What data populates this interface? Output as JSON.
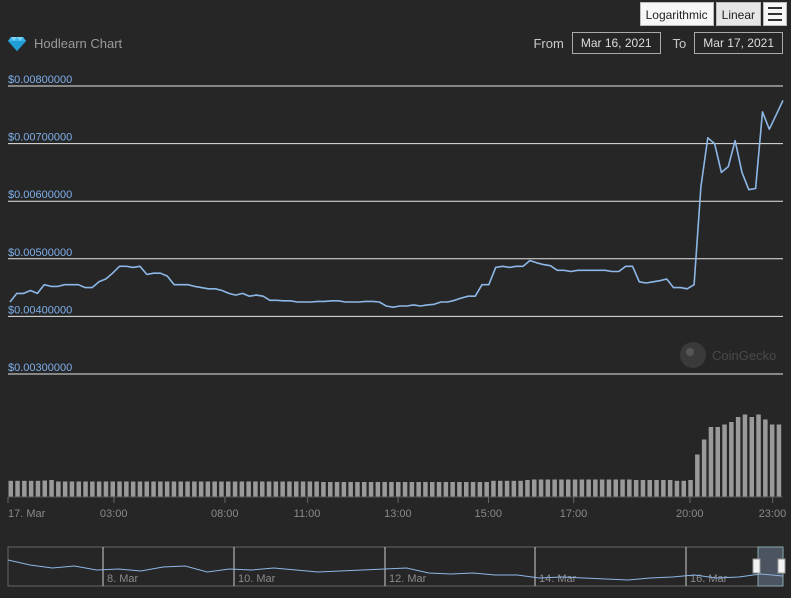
{
  "toolbar": {
    "logarithmic_label": "Logarithmic",
    "linear_label": "Linear"
  },
  "header": {
    "title": "Hodlearn Chart",
    "from_label": "From",
    "from_value": "Mar 16, 2021",
    "to_label": "To",
    "to_value": "Mar 17, 2021"
  },
  "watermark": "CoinGecko",
  "colors": {
    "background": "#262626",
    "line": "#8db7e6",
    "axis_label": "#7fb0ea",
    "grid": "#e6e6e6",
    "volume": "#9a9a9a"
  },
  "chart_data": {
    "type": "line",
    "title": "",
    "xlabel": "",
    "ylabel": "",
    "ylim": [
      0.003,
      0.008
    ],
    "yticks": [
      "$0.00800000",
      "$0.00700000",
      "$0.00600000",
      "$0.00500000",
      "$0.00400000",
      "$0.00300000"
    ],
    "ytick_values": [
      0.008,
      0.007,
      0.006,
      0.005,
      0.004,
      0.003
    ],
    "xticks": [
      "17. Mar",
      "03:00",
      "08:00",
      "11:00",
      "13:00",
      "15:00",
      "17:00",
      "20:00",
      "23:00"
    ],
    "xtick_hours": [
      0,
      4.1,
      8.4,
      11.6,
      15.1,
      18.6,
      21.9,
      26.4,
      29.6
    ],
    "x_hours_max": 30.0,
    "series": [
      {
        "values": [
          0.00425,
          0.0044,
          0.0044,
          0.00445,
          0.0044,
          0.00455,
          0.00452,
          0.00452,
          0.00455,
          0.00455,
          0.00455,
          0.0045,
          0.0045,
          0.0046,
          0.00465,
          0.00475,
          0.00487,
          0.00487,
          0.00485,
          0.00487,
          0.00473,
          0.00475,
          0.00475,
          0.0047,
          0.00455,
          0.00455,
          0.00455,
          0.00452,
          0.0045,
          0.00448,
          0.00448,
          0.00445,
          0.0044,
          0.00437,
          0.0044,
          0.00435,
          0.00437,
          0.00435,
          0.00428,
          0.00428,
          0.00427,
          0.00427,
          0.00425,
          0.00425,
          0.00425,
          0.00426,
          0.00426,
          0.00427,
          0.00427,
          0.00425,
          0.00425,
          0.00425,
          0.00426,
          0.00426,
          0.00425,
          0.00418,
          0.00416,
          0.00418,
          0.00418,
          0.0042,
          0.00418,
          0.0042,
          0.00421,
          0.00425,
          0.00425,
          0.00428,
          0.00432,
          0.00435,
          0.00435,
          0.00455,
          0.00455,
          0.00485,
          0.00487,
          0.00485,
          0.00487,
          0.00487,
          0.00497,
          0.00493,
          0.0049,
          0.00488,
          0.0048,
          0.0048,
          0.00478,
          0.0048,
          0.0048,
          0.0048,
          0.0048,
          0.0048,
          0.00478,
          0.00478,
          0.00487,
          0.00487,
          0.0046,
          0.00458,
          0.0046,
          0.00462,
          0.00465,
          0.0045,
          0.0045,
          0.00448,
          0.00455,
          0.00625,
          0.0071,
          0.007,
          0.0065,
          0.0066,
          0.00705,
          0.0065,
          0.0062,
          0.00622,
          0.00755,
          0.00725,
          0.0075,
          0.00775
        ]
      }
    ],
    "volume": [
      0.65,
      0.65,
      0.65,
      0.65,
      0.65,
      0.66,
      0.68,
      0.62,
      0.62,
      0.62,
      0.62,
      0.62,
      0.62,
      0.62,
      0.62,
      0.62,
      0.62,
      0.62,
      0.62,
      0.62,
      0.62,
      0.62,
      0.62,
      0.62,
      0.62,
      0.62,
      0.62,
      0.62,
      0.62,
      0.62,
      0.62,
      0.62,
      0.62,
      0.62,
      0.62,
      0.62,
      0.62,
      0.62,
      0.62,
      0.62,
      0.62,
      0.62,
      0.62,
      0.62,
      0.62,
      0.62,
      0.6,
      0.6,
      0.6,
      0.6,
      0.6,
      0.6,
      0.6,
      0.6,
      0.6,
      0.6,
      0.6,
      0.6,
      0.6,
      0.6,
      0.6,
      0.6,
      0.6,
      0.6,
      0.6,
      0.6,
      0.6,
      0.6,
      0.6,
      0.6,
      0.6,
      0.65,
      0.65,
      0.65,
      0.65,
      0.65,
      0.68,
      0.7,
      0.7,
      0.7,
      0.7,
      0.7,
      0.7,
      0.7,
      0.7,
      0.7,
      0.7,
      0.7,
      0.7,
      0.7,
      0.7,
      0.7,
      0.68,
      0.68,
      0.68,
      0.68,
      0.68,
      0.68,
      0.65,
      0.65,
      0.68,
      1.7,
      2.3,
      2.8,
      2.8,
      2.9,
      3.0,
      3.2,
      3.3,
      3.2,
      3.3,
      3.1,
      2.9,
      2.9
    ],
    "navigator": {
      "labels": [
        "8. Mar",
        "10. Mar",
        "12. Mar",
        "14. Mar",
        "16. Mar"
      ]
    },
    "grid": true,
    "legend": "none"
  }
}
